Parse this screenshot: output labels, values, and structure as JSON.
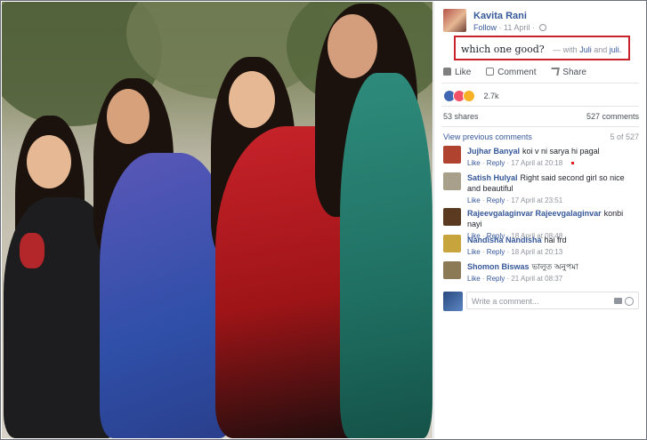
{
  "post": {
    "author": "Kavita Rani",
    "follow": "Follow",
    "date": "· 11 April ·",
    "caption": "which one good?",
    "with_prefix": "— with",
    "tag1": "Juli",
    "and": "and",
    "tag2": "juli."
  },
  "actions": {
    "like": "Like",
    "comment": "Comment",
    "share": "Share"
  },
  "reactions": {
    "count": "2.7k"
  },
  "stats": {
    "shares": "53 shares",
    "comments": "527 comments"
  },
  "comments_header": {
    "view_previous": "View previous comments",
    "pager": "5 of 527"
  },
  "comments": [
    {
      "name": "Jujhar Banyal",
      "text": "koi v ni sarya hi pagal",
      "like": "Like",
      "reply": "Reply",
      "date": "17 April at 20:18",
      "avatar_color": "#b0432f"
    },
    {
      "name": "Satish Hulyal",
      "text": "Right said second girl so nice and beautiful",
      "like": "Like",
      "reply": "Reply",
      "date": "17 April at 23:51",
      "avatar_color": "#a8a08a"
    },
    {
      "name": "Rajeevgalaginvar Rajeevgalaginvar",
      "text": "konbi nayi",
      "like": "Like",
      "reply": "Reply",
      "date": "18 April at 08:48",
      "avatar_color": "#5a3b22"
    },
    {
      "name": "Nandisha Nandisha",
      "text": "hai frd",
      "like": "Like",
      "reply": "Reply",
      "date": "18 April at 20:13",
      "avatar_color": "#c8a43c"
    },
    {
      "name": "Shomon Biswas",
      "text": "ভালুত অনুপমা",
      "like": "Like",
      "reply": "Reply",
      "date": "21 April at 08:37",
      "avatar_color": "#8b7a55"
    }
  ],
  "write": {
    "placeholder": "Write a comment..."
  },
  "colors": {
    "link": "#365899",
    "highlight_border": "#c8232b",
    "meta": "#90949c"
  }
}
